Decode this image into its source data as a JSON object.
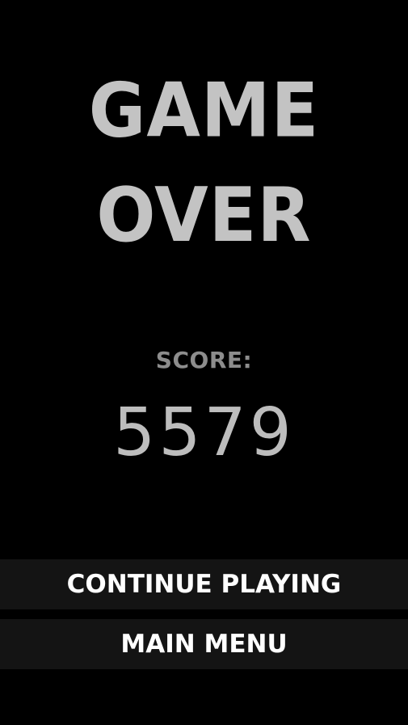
{
  "screen": {
    "title": "GAME OVER",
    "score_label": "SCORE:",
    "score_value": "5579"
  },
  "menu": {
    "continue_label": "CONTINUE PLAYING",
    "main_menu_label": "MAIN MENU"
  },
  "colors": {
    "background": "#000000",
    "title": "#c3c3c3",
    "score_label": "#8d8d8d",
    "score_value": "#bdbdbd",
    "button_background": "#141414",
    "button_text": "#ffffff"
  }
}
